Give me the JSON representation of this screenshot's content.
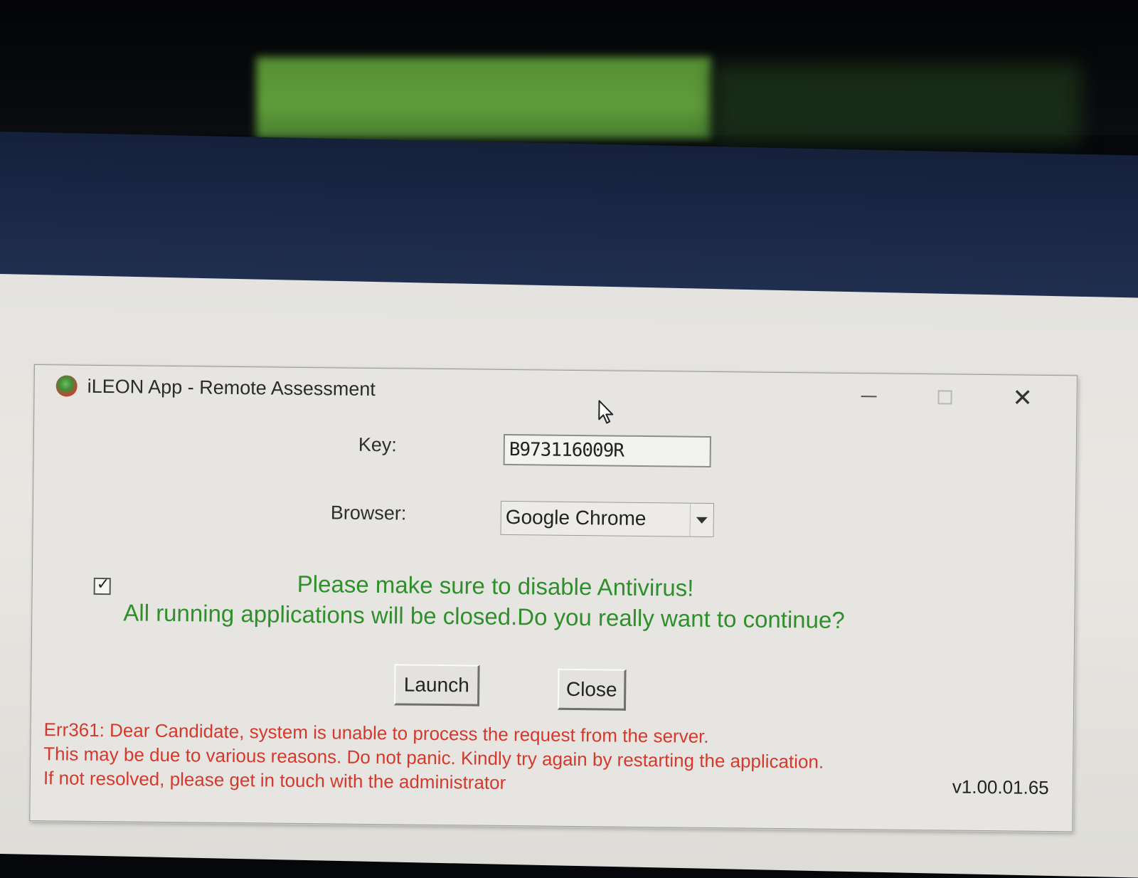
{
  "window": {
    "title": "iLEON App - Remote Assessment",
    "icon": "app-logo-icon"
  },
  "form": {
    "key_label": "Key:",
    "key_value": "B973116009R",
    "browser_label": "Browser:",
    "browser_value": "Google Chrome",
    "confirm_checked": true
  },
  "warning": {
    "line1": "Please make sure to disable Antivirus!",
    "line2": "All running applications will be closed.Do you really want to continue?",
    "color": "#2f8f2a"
  },
  "buttons": {
    "launch": "Launch",
    "close": "Close"
  },
  "error": {
    "line1": "Err361: Dear Candidate, system is unable to process the request from the server.",
    "line2": "This may be due to various reasons. Do not panic. Kindly try again by restarting the application.",
    "line3": "If not resolved, please get in touch with the administrator",
    "color": "#d6392c"
  },
  "version": "v1.00.01.65"
}
